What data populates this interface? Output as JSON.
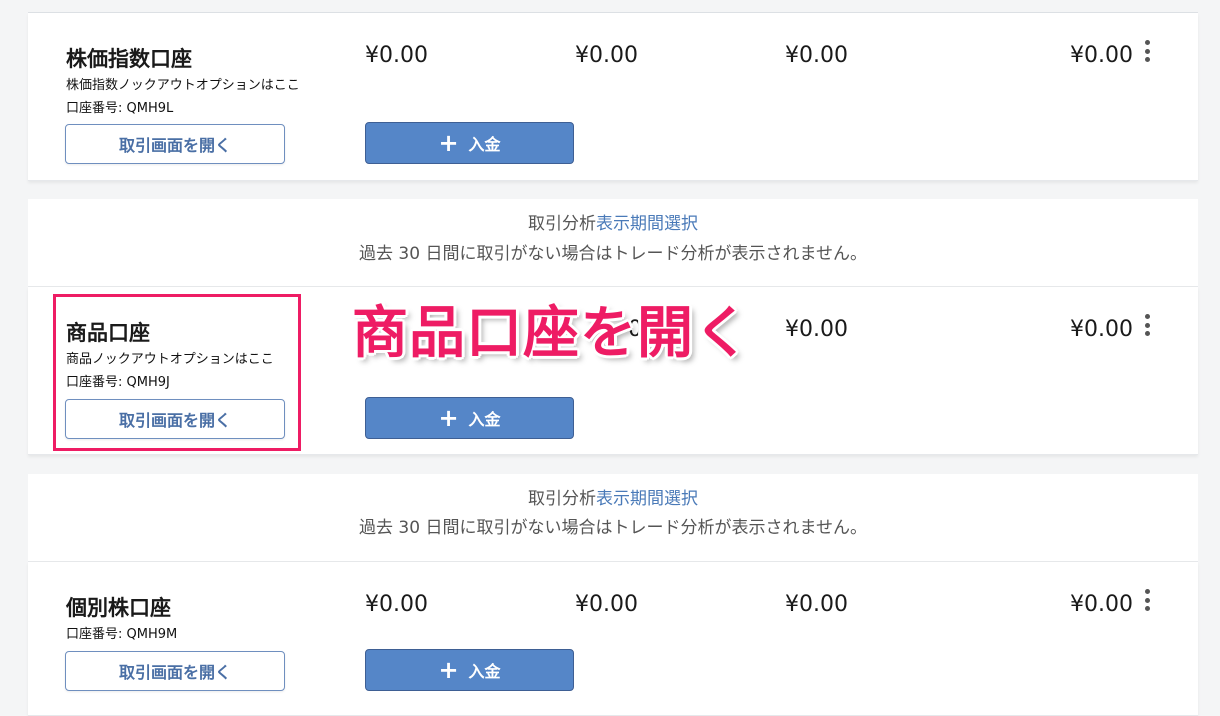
{
  "accounts": [
    {
      "name": "株価指数口座",
      "description": "株価指数ノックアウトオプションはここ",
      "account_number": "口座番号: QMH9L",
      "amounts": [
        "¥0.00",
        "¥0.00",
        "¥0.00",
        "¥0.00"
      ],
      "open_label": "取引画面を開く",
      "deposit_label": "入金"
    },
    {
      "name": "商品口座",
      "description": "商品ノックアウトオプションはここ",
      "account_number": "口座番号: QMH9J",
      "amounts": [
        "¥0.00",
        "¥0.00"
      ],
      "partial_amount_char": "0",
      "open_label": "取引画面を開く",
      "deposit_label": "入金"
    },
    {
      "name": "個別株口座",
      "account_number": "口座番号: QMH9M",
      "amounts": [
        "¥0.00",
        "¥0.00",
        "¥0.00",
        "¥0.00"
      ],
      "open_label": "取引画面を開く",
      "deposit_label": "入金"
    }
  ],
  "analysis": {
    "prefix": "取引分析",
    "link": "表示期間選択",
    "note": "過去 30 日間に取引がない場合はトレード分析が表示されません。"
  },
  "annotation": {
    "title": "商品口座を開く",
    "color": "#ee1c64"
  },
  "colors": {
    "deposit_button": "#5586c8",
    "open_button_text": "#4a6fa5",
    "link": "#4a7ab8"
  }
}
